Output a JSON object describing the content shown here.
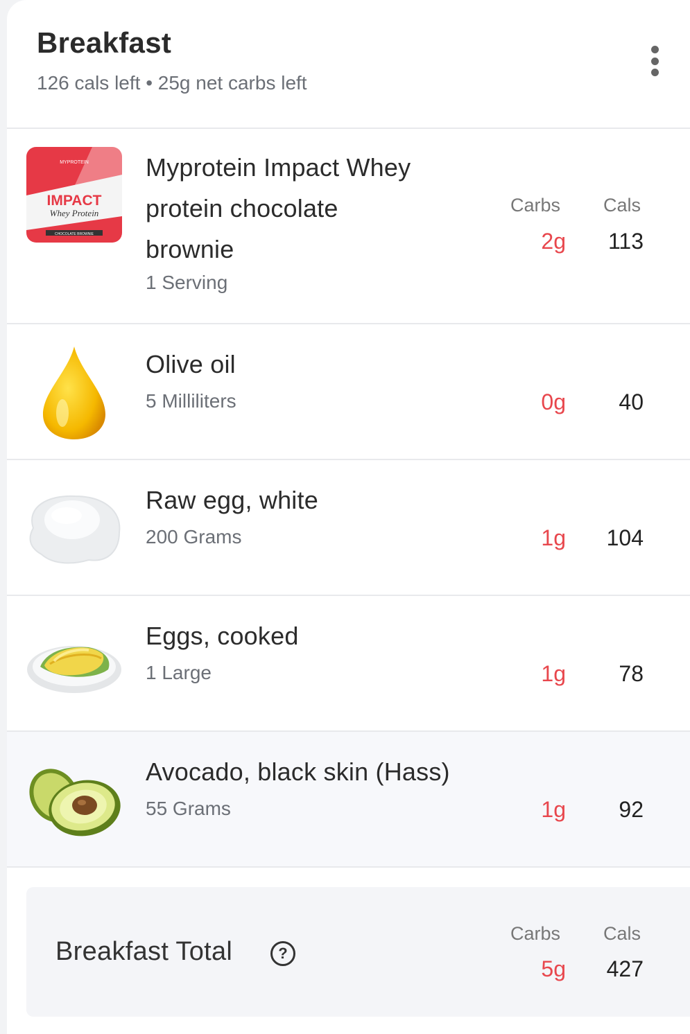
{
  "meal": {
    "title": "Breakfast",
    "subtitle": "126 cals left • 25g net carbs left"
  },
  "columns": {
    "carbs": "Carbs",
    "cals": "Cals"
  },
  "items": [
    {
      "name_lines": [
        "Myprotein Impact Whey",
        "protein chocolate",
        "brownie"
      ],
      "amount": "1 Serving",
      "carbs": "2g",
      "cals": "113",
      "image": "protein-pouch-icon",
      "packaging_text": [
        "MYPROTEIN",
        "IMPACT",
        "Whey Protein",
        "CHOCOLATE BROWNIE"
      ]
    },
    {
      "name": "Olive oil",
      "amount": "5 Milliliters",
      "carbs": "0g",
      "cals": "40",
      "image": "oil-drop-icon"
    },
    {
      "name": "Raw egg, white",
      "amount": "200 Grams",
      "carbs": "1g",
      "cals": "104",
      "image": "raw-egg-white-icon"
    },
    {
      "name": "Eggs, cooked",
      "amount": "1 Large",
      "carbs": "1g",
      "cals": "78",
      "image": "omelette-plate-icon"
    },
    {
      "name": "Avocado, black skin (Hass)",
      "amount": "55 Grams",
      "carbs": "1g",
      "cals": "92",
      "image": "avocado-icon"
    }
  ],
  "total": {
    "label": "Breakfast Total",
    "help": "?",
    "carbs": "5g",
    "cals": "427"
  },
  "colors": {
    "carbs": "#e8474d",
    "text": "#2b2b2b",
    "muted": "#6b6f76"
  }
}
